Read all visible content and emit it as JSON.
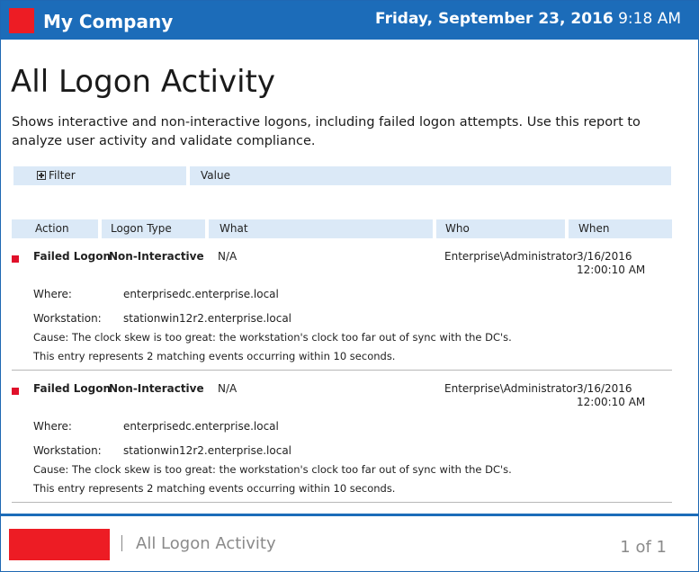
{
  "header": {
    "company": "My Company",
    "date": "Friday, September 23, 2016",
    "time": "9:18 AM"
  },
  "report": {
    "title": "All Logon Activity",
    "description": "Shows interactive and non-interactive logons, including failed logon attempts. Use this report to analyze user activity and validate compliance."
  },
  "filter_bar": {
    "filter_label": "Filter",
    "value_label": "Value"
  },
  "columns": [
    "Action",
    "Logon Type",
    "What",
    "Who",
    "When"
  ],
  "entries": [
    {
      "action": "Failed Logon",
      "logon_type": "Non-Interactive",
      "what": "N/A",
      "who": "Enterprise\\Administrator",
      "when_date": "3/16/2016",
      "when_time": "12:00:10 AM",
      "where_label": "Where:",
      "where_value": "enterprisedc.enterprise.local",
      "workstation_label": "Workstation:",
      "workstation_value": "stationwin12r2.enterprise.local",
      "cause": "Cause: The clock skew is too great: the workstation's clock too far out of sync with the DC's.",
      "note": "This entry represents 2 matching events occurring within 10 seconds."
    },
    {
      "action": "Failed Logon",
      "logon_type": "Non-Interactive",
      "what": "N/A",
      "who": "Enterprise\\Administrator",
      "when_date": "3/16/2016",
      "when_time": "12:00:10 AM",
      "where_label": "Where:",
      "where_value": "enterprisedc.enterprise.local",
      "workstation_label": "Workstation:",
      "workstation_value": "stationwin12r2.enterprise.local",
      "cause": "Cause: The clock skew is too great: the workstation's clock too far out of sync with the DC's.",
      "note": "This entry represents 2 matching events occurring within 10 seconds."
    }
  ],
  "footer": {
    "title": "All Logon Activity",
    "pager": "1 of 1"
  },
  "colors": {
    "brand_blue": "#1c6cb9",
    "logo_red": "#ed1c24",
    "header_band": "#dbe9f7",
    "failed_marker": "#e0102a"
  },
  "icons": {
    "filter_expand": "plus-box-icon",
    "status_marker": "red-square-icon"
  }
}
